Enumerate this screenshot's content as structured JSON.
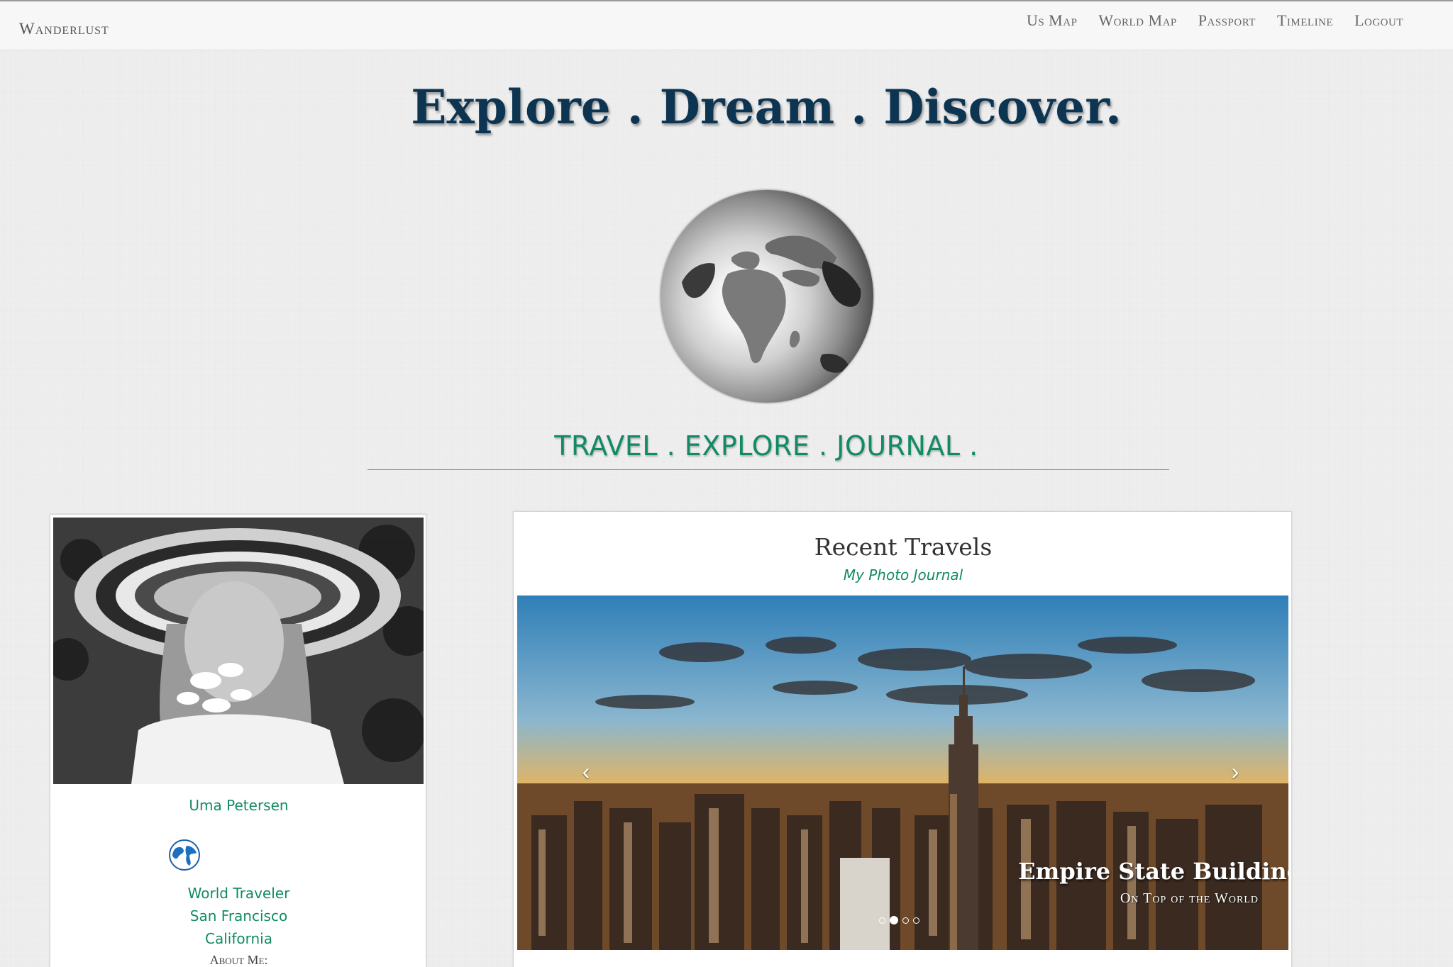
{
  "navbar": {
    "brand": "Wanderlust",
    "links": [
      "Us Map",
      "World Map",
      "Passport",
      "Timeline",
      "Logout"
    ]
  },
  "hero": {
    "title": "Explore . Dream . Discover.",
    "tagline": "TRAVEL . EXPLORE . JOURNAL ."
  },
  "profile": {
    "name": "Uma Petersen",
    "line1": "World Traveler",
    "line2": "San Francisco",
    "line3": "California",
    "about_label": "About Me:"
  },
  "travels": {
    "title": "Recent Travels",
    "subtitle": "My Photo Journal",
    "slide_caption_title": "Empire State Building",
    "slide_caption_subtitle": "On Top of the World",
    "slide_count": 4,
    "active_slide": 2,
    "prev_arrow": "‹",
    "next_arrow": "›"
  },
  "colors": {
    "title": "#0d3552",
    "accent_green": "#118a66"
  }
}
